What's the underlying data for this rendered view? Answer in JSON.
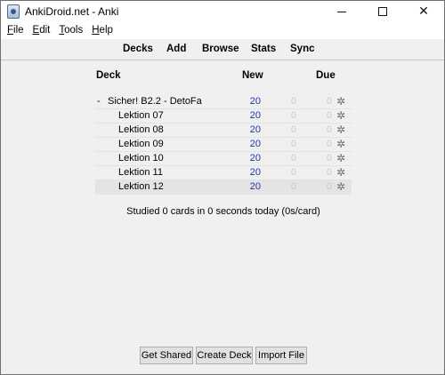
{
  "window": {
    "title": "AnkiDroid.net - Anki",
    "icon": "anki-app-icon"
  },
  "menubar": {
    "items": [
      {
        "label": "File",
        "mnemonic": "F"
      },
      {
        "label": "Edit",
        "mnemonic": "E"
      },
      {
        "label": "Tools",
        "mnemonic": "T"
      },
      {
        "label": "Help",
        "mnemonic": "H"
      }
    ]
  },
  "toolbar": {
    "decks": "Decks",
    "add": "Add",
    "browse": "Browse",
    "stats": "Stats",
    "sync": "Sync"
  },
  "deck_table": {
    "headers": {
      "deck": "Deck",
      "new": "New",
      "due": "Due"
    },
    "parent": {
      "collapse": "-",
      "name": "Sicher! B2.2 - DetoFa",
      "new": "20",
      "learn": "0",
      "due": "0"
    },
    "children": [
      {
        "name": "Lektion 07",
        "new": "20",
        "learn": "0",
        "due": "0"
      },
      {
        "name": "Lektion 08",
        "new": "20",
        "learn": "0",
        "due": "0"
      },
      {
        "name": "Lektion 09",
        "new": "20",
        "learn": "0",
        "due": "0"
      },
      {
        "name": "Lektion 10",
        "new": "20",
        "learn": "0",
        "due": "0"
      },
      {
        "name": "Lektion 11",
        "new": "20",
        "learn": "0",
        "due": "0"
      },
      {
        "name": "Lektion 12",
        "new": "20",
        "learn": "0",
        "due": "0"
      }
    ],
    "gear_glyph": "✲"
  },
  "status": {
    "studied": "Studied 0 cards in 0 seconds today (0s/card)"
  },
  "bottom_buttons": {
    "get_shared": "Get Shared",
    "create_deck": "Create Deck",
    "import_file": "Import File"
  },
  "colors": {
    "new_count": "#1f35a8",
    "zero_count": "#c8c8c8",
    "current_row": "#e4e4e4"
  }
}
